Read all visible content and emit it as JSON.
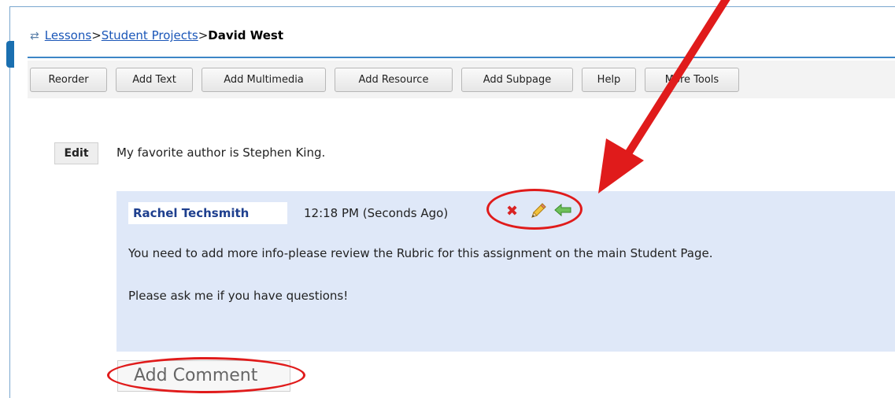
{
  "breadcrumb": {
    "refresh_icon": "refresh-arrows-icon",
    "lessons": "Lessons",
    "sep1": ">",
    "student_projects": "Student Projects",
    "sep2": ">",
    "current": "David West"
  },
  "toolbar": {
    "reorder": "Reorder",
    "add_text": "Add Text",
    "add_multimedia": "Add Multimedia",
    "add_resource": "Add Resource",
    "add_subpage": "Add Subpage",
    "help": "Help",
    "more_tools": "More Tools"
  },
  "content": {
    "edit_label": "Edit",
    "text": "My favorite author is Stephen King."
  },
  "comment": {
    "author": "Rachel Techsmith",
    "timestamp": "12:18 PM (Seconds Ago)",
    "icons": [
      "delete-icon",
      "pencil-edit-icon",
      "reply-arrow-icon"
    ],
    "line1": "You need to add more info-please review the Rubric for this assignment on the main Student Page.",
    "line2": "Please ask me if you have questions!"
  },
  "add_comment": "Add Comment",
  "colors": {
    "annotation_red": "#e01b1b",
    "comment_bg": "#dfe8f8",
    "link_blue": "#1a56b8",
    "rule_blue": "#3d86c6"
  }
}
